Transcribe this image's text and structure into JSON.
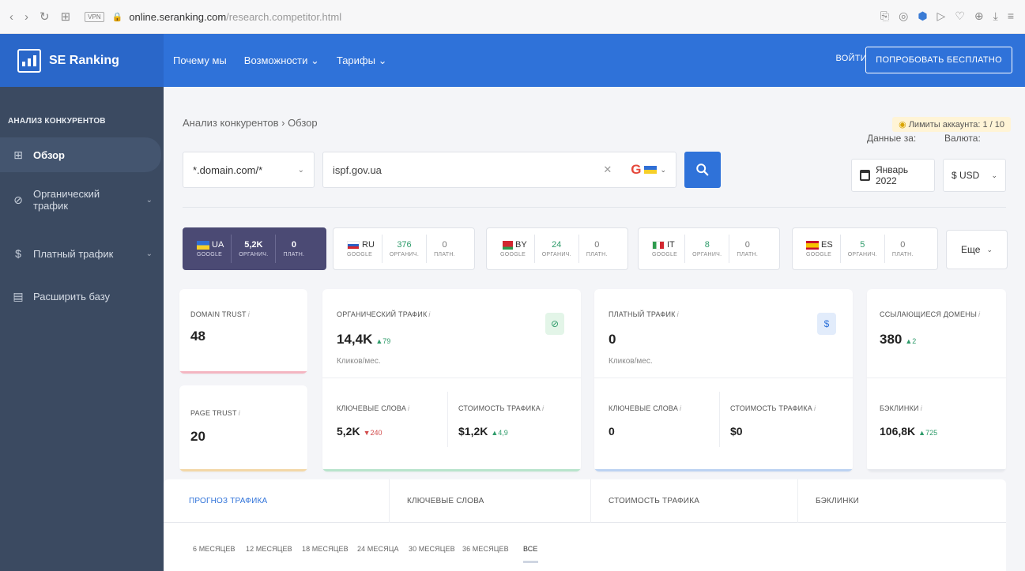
{
  "browser": {
    "url_host": "online.seranking.com",
    "url_path": "/research.competitor.html",
    "vpn_label": "VPN"
  },
  "header": {
    "brand": "SE Ranking",
    "nav": [
      "Почему мы",
      "Возможности ⌄",
      "Тарифы ⌄"
    ],
    "login": "ВОЙТИ",
    "try_free": "ПОПРОБОВАТЬ БЕСПЛАТНО"
  },
  "sidebar": {
    "title": "АНАЛИЗ КОНКУРЕНТОВ",
    "items": [
      {
        "label": "Обзор",
        "icon": "grid-icon"
      },
      {
        "label": "Органический трафик",
        "icon": "leaf-icon"
      },
      {
        "label": "Платный трафик",
        "icon": "dollar-icon"
      },
      {
        "label": "Расширить базу",
        "icon": "database-icon"
      }
    ]
  },
  "main": {
    "breadcrumb": "Анализ конкурентов  ›  Обзор",
    "limits": "Лимиты аккаунта: 1 / 10",
    "scope_select": "*.domain.com/*",
    "domain_value": "ispf.gov.ua",
    "date_label": "Данные за:",
    "currency_label": "Валюта:",
    "date_value": "Январь 2022",
    "currency_value": "$ USD",
    "more": "Еще"
  },
  "countries": [
    {
      "code": "UA",
      "engine": "GOOGLE",
      "organic": "5,2K",
      "paid": "0",
      "organic_lbl": "ОРГАНИЧ.",
      "paid_lbl": "ПЛАТН."
    },
    {
      "code": "RU",
      "engine": "GOOGLE",
      "organic": "376",
      "paid": "0",
      "organic_lbl": "ОРГАНИЧ.",
      "paid_lbl": "ПЛАТН."
    },
    {
      "code": "BY",
      "engine": "GOOGLE",
      "organic": "24",
      "paid": "0",
      "organic_lbl": "ОРГАНИЧ.",
      "paid_lbl": "ПЛАТН."
    },
    {
      "code": "IT",
      "engine": "GOOGLE",
      "organic": "8",
      "paid": "0",
      "organic_lbl": "ОРГАНИЧ.",
      "paid_lbl": "ПЛАТН."
    },
    {
      "code": "ES",
      "engine": "GOOGLE",
      "organic": "5",
      "paid": "0",
      "organic_lbl": "ОРГАНИЧ.",
      "paid_lbl": "ПЛАТН."
    }
  ],
  "cards": {
    "domain_trust": {
      "label": "DOMAIN TRUST",
      "value": "48"
    },
    "page_trust": {
      "label": "PAGE TRUST",
      "value": "20"
    },
    "organic": {
      "label": "ОРГАНИЧЕСКИЙ ТРАФИК",
      "value": "14,4K",
      "delta": "▲79",
      "sub": "Кликов/мес.",
      "kw_label": "КЛЮЧЕВЫЕ СЛОВА",
      "kw_value": "5,2K",
      "kw_delta": "▼240",
      "cost_label": "СТОИМОСТЬ ТРАФИКА",
      "cost_value": "$1,2K",
      "cost_delta": "▲4,9"
    },
    "paid": {
      "label": "ПЛАТНЫЙ ТРАФИК",
      "value": "0",
      "sub": "Кликов/мес.",
      "kw_label": "КЛЮЧЕВЫЕ СЛОВА",
      "kw_value": "0",
      "cost_label": "СТОИМОСТЬ ТРАФИКА",
      "cost_value": "$0"
    },
    "ref": {
      "label": "ССЫЛАЮЩИЕСЯ ДОМЕНЫ",
      "value": "380",
      "delta": "▲2",
      "bl_label": "БЭКЛИНКИ",
      "bl_value": "106,8K",
      "bl_delta": "▲725"
    }
  },
  "tabs": [
    "ПРОГНОЗ ТРАФИКА",
    "КЛЮЧЕВЫЕ СЛОВА",
    "СТОИМОСТЬ ТРАФИКА",
    "БЭКЛИНКИ"
  ],
  "periods": [
    "6 МЕСЯЦЕВ",
    "12 МЕСЯЦЕВ",
    "18 МЕСЯЦЕВ",
    "24 МЕСЯЦА",
    "30 МЕСЯЦЕВ",
    "36 МЕСЯЦЕВ",
    "ВСЕ"
  ],
  "colors": {
    "brand": "#2f72d9",
    "sidebar": "#3b4a61",
    "active_country": "#4b4a74",
    "up": "#2e9b6a",
    "down": "#d24b4b"
  }
}
